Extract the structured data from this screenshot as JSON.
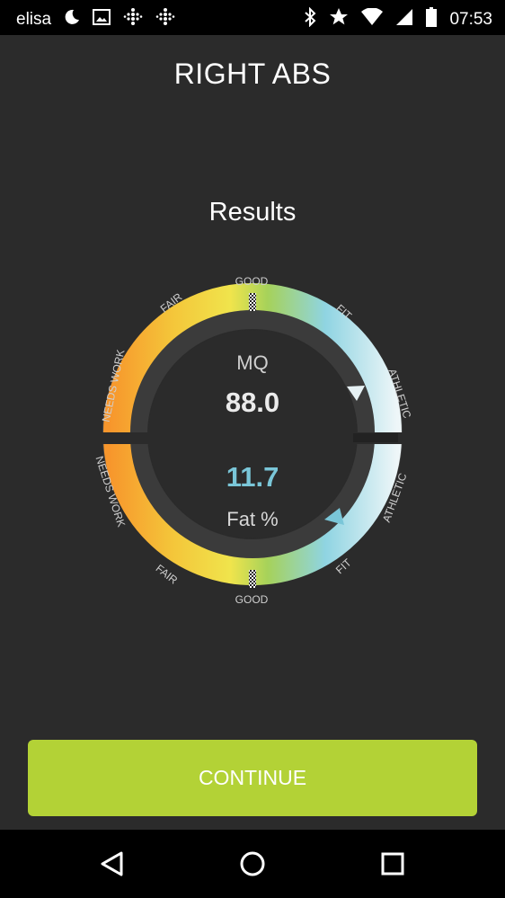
{
  "status_bar": {
    "carrier": "elisa",
    "time": "07:53",
    "left_icons": [
      "moon-icon",
      "image-icon",
      "fitbit-icon",
      "fitbit-icon"
    ],
    "right_icons": [
      "bluetooth-icon",
      "star-icon",
      "wifi-icon",
      "signal-icon",
      "battery-icon"
    ]
  },
  "header": {
    "title": "RIGHT ABS"
  },
  "results": {
    "heading": "Results",
    "mq_label": "MQ",
    "mq_value": "88.0",
    "fat_value": "11.7",
    "fat_label": "Fat %"
  },
  "gauge": {
    "top_labels": [
      "NEEDS WORK",
      "FAIR",
      "GOOD",
      "FIT",
      "ATHLETIC"
    ],
    "bottom_labels": [
      "NEEDS WORK",
      "FAIR",
      "GOOD",
      "FIT",
      "ATHLETIC"
    ],
    "colors": {
      "orange": "#f7962c",
      "yellow": "#f4e04a",
      "green": "#a6d25a",
      "blue": "#8fd4e2",
      "white": "#eef6f8",
      "marker_top": "#e6f1f4",
      "marker_bottom": "#7ac6d8"
    }
  },
  "buttons": {
    "continue_label": "CONTINUE"
  },
  "nav": {
    "icons": [
      "back-icon",
      "home-icon",
      "recents-icon"
    ]
  }
}
